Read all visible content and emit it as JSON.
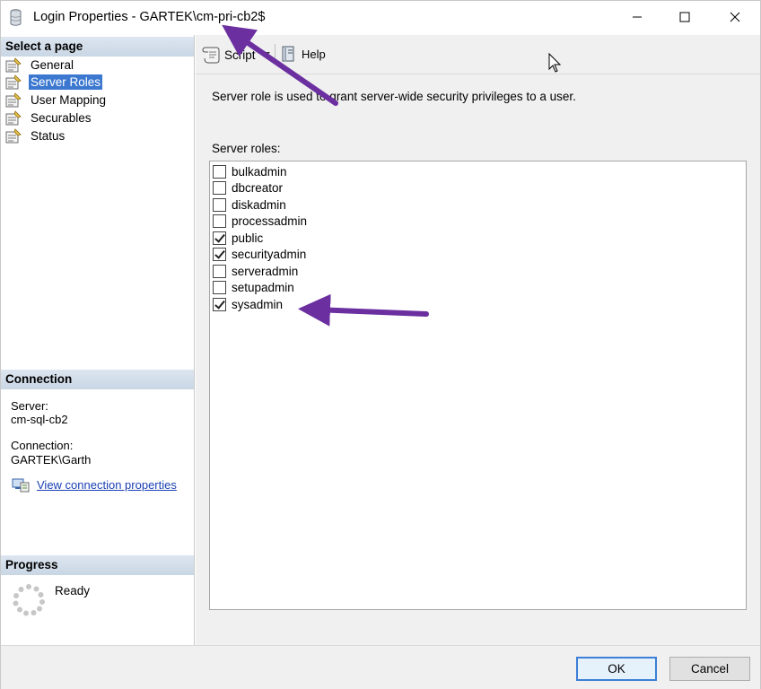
{
  "window": {
    "title": "Login Properties - GARTEK\\cm-pri-cb2$",
    "title_icon": "database-icon",
    "controls": [
      "minimize-icon",
      "maximize-icon",
      "close-icon"
    ]
  },
  "left_pane": {
    "select_page_header": "Select a page",
    "pages": [
      {
        "label": "General",
        "selected": false
      },
      {
        "label": "Server Roles",
        "selected": true
      },
      {
        "label": "User Mapping",
        "selected": false
      },
      {
        "label": "Securables",
        "selected": false
      },
      {
        "label": "Status",
        "selected": false
      }
    ],
    "connection_header": "Connection",
    "server_label": "Server:",
    "server_value": "cm-sql-cb2",
    "connection_label": "Connection:",
    "connection_value": "GARTEK\\Garth",
    "view_connection_link": "View connection properties",
    "progress_header": "Progress",
    "progress_status": "Ready"
  },
  "toolbar": {
    "script_label": "Script",
    "help_label": "Help"
  },
  "main": {
    "description": "Server role is used to grant server-wide security privileges to a user.",
    "roles_label": "Server roles:",
    "roles": [
      {
        "name": "bulkadmin",
        "checked": false
      },
      {
        "name": "dbcreator",
        "checked": false
      },
      {
        "name": "diskadmin",
        "checked": false
      },
      {
        "name": "processadmin",
        "checked": false
      },
      {
        "name": "public",
        "checked": true
      },
      {
        "name": "securityadmin",
        "checked": true
      },
      {
        "name": "serveradmin",
        "checked": false
      },
      {
        "name": "setupadmin",
        "checked": false
      },
      {
        "name": "sysadmin",
        "checked": true
      }
    ]
  },
  "buttons": {
    "ok": "OK",
    "cancel": "Cancel"
  },
  "colors": {
    "selection": "#3c78d0",
    "annotation_arrow": "#6b2fa0",
    "link": "#1a3fb3"
  }
}
